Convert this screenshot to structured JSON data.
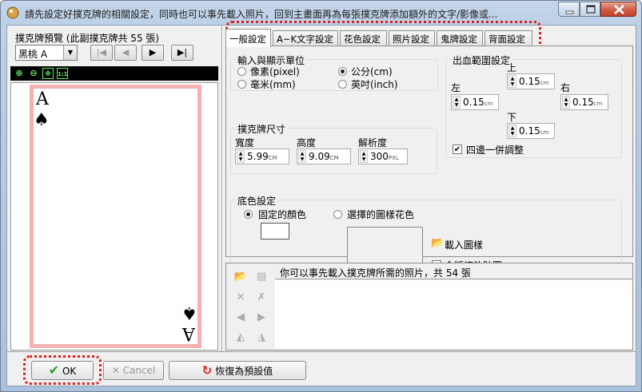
{
  "window": {
    "title": "請先設定好撲克牌的相關設定，同時也可以事先載入照片，回到主畫面再為每張撲克牌添加額外的文字/影像或..."
  },
  "preview": {
    "header": "撲克牌預覽 (此副撲克牌共 55 張)",
    "selected_card": "黑桃 A",
    "nav_first": "|◀",
    "nav_prev": "◀",
    "nav_next": "▶",
    "nav_last": "▶|",
    "card_rank": "A",
    "card_suit": "♠",
    "border_color": "#f4b1b1"
  },
  "tabs": [
    {
      "label": "一般設定",
      "active": true
    },
    {
      "label": "A~K文字設定"
    },
    {
      "label": "花色設定"
    },
    {
      "label": "照片設定"
    },
    {
      "label": "鬼牌設定"
    },
    {
      "label": "背面設定"
    }
  ],
  "units": {
    "title": "輸入與顯示單位",
    "pixel": "像素(pixel)",
    "cm": "公分(cm)",
    "mm": "毫米(mm)",
    "inch": "英吋(inch)",
    "selected": "cm"
  },
  "card_size": {
    "title": "撲克牌尺寸",
    "width_label": "寬度",
    "width": "5.99",
    "width_unit": "CM",
    "height_label": "高度",
    "height": "9.09",
    "height_unit": "CM",
    "dpi_label": "解析度",
    "dpi": "300",
    "dpi_unit": "PXL"
  },
  "bleed": {
    "title": "出血範圍設定",
    "top_label": "上",
    "top": "0.15",
    "left_label": "左",
    "left": "0.15",
    "right_label": "右",
    "right": "0.15",
    "bottom_label": "下",
    "bottom": "0.15",
    "unit": "cm",
    "adjust_all_label": "四邊一併調整",
    "adjust_all": true
  },
  "background": {
    "title": "底色設定",
    "fixed_color_label": "固定的顏色",
    "pattern_label": "選擇的圖樣花色",
    "selected": "fixed",
    "color": "#ffffff",
    "load_pattern_label": "載入圖樣",
    "stretch_label": "全版縮放貼圖",
    "stretch": false
  },
  "photos": {
    "info": "你可以事先載入撲克牌所需的照片，共 54 張"
  },
  "buttons": {
    "ok": "OK",
    "cancel": "Cancel",
    "restore": "恢復為預設值"
  },
  "colors": {
    "highlight": "#e02020",
    "ok_check": "#2a9d2a",
    "restore_icon": "#d22"
  }
}
